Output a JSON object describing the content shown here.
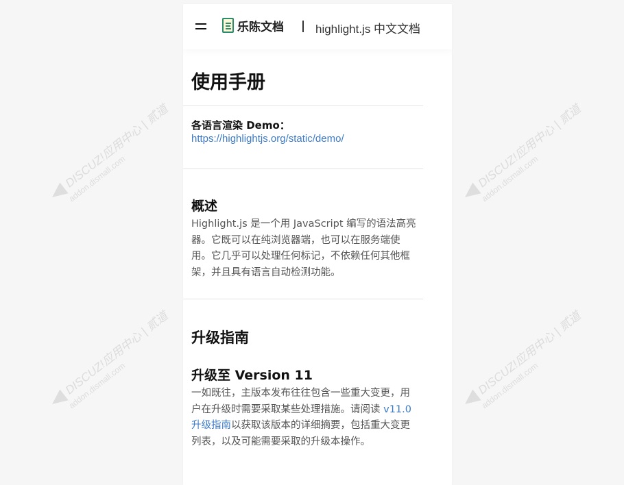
{
  "header": {
    "logo_text": "乐陈文档",
    "site_subtitle": "highlight.js 中文文档"
  },
  "page_title": "使用手册",
  "demo": {
    "label": "各语言渲染 Demo：",
    "link": "https://highlightjs.org/static/demo/"
  },
  "overview": {
    "heading": "概述",
    "text": "Highlight.js 是一个用 JavaScript 编写的语法高亮器。它既可以在纯浏览器端，也可以在服务端使用。它几乎可以处理任何标记，不依赖任何其他框架，并且具有语言自动检测功能。"
  },
  "upgrade": {
    "heading": "升级指南",
    "subheading": "升级至 Version 11",
    "text_before": "一如既往，主版本发布往往包含一些重大变更，用户在升级时需要采取某些处理措施。请阅读 ",
    "link": "v11.0 升级指南",
    "text_after": "以获取该版本的详细摘要，包括重大变更列表，以及可能需要采取的升级本操作。"
  },
  "watermark": {
    "brand": "DISCUZ!应用中心 | 贰道",
    "domain": "addon.dismall.com"
  }
}
